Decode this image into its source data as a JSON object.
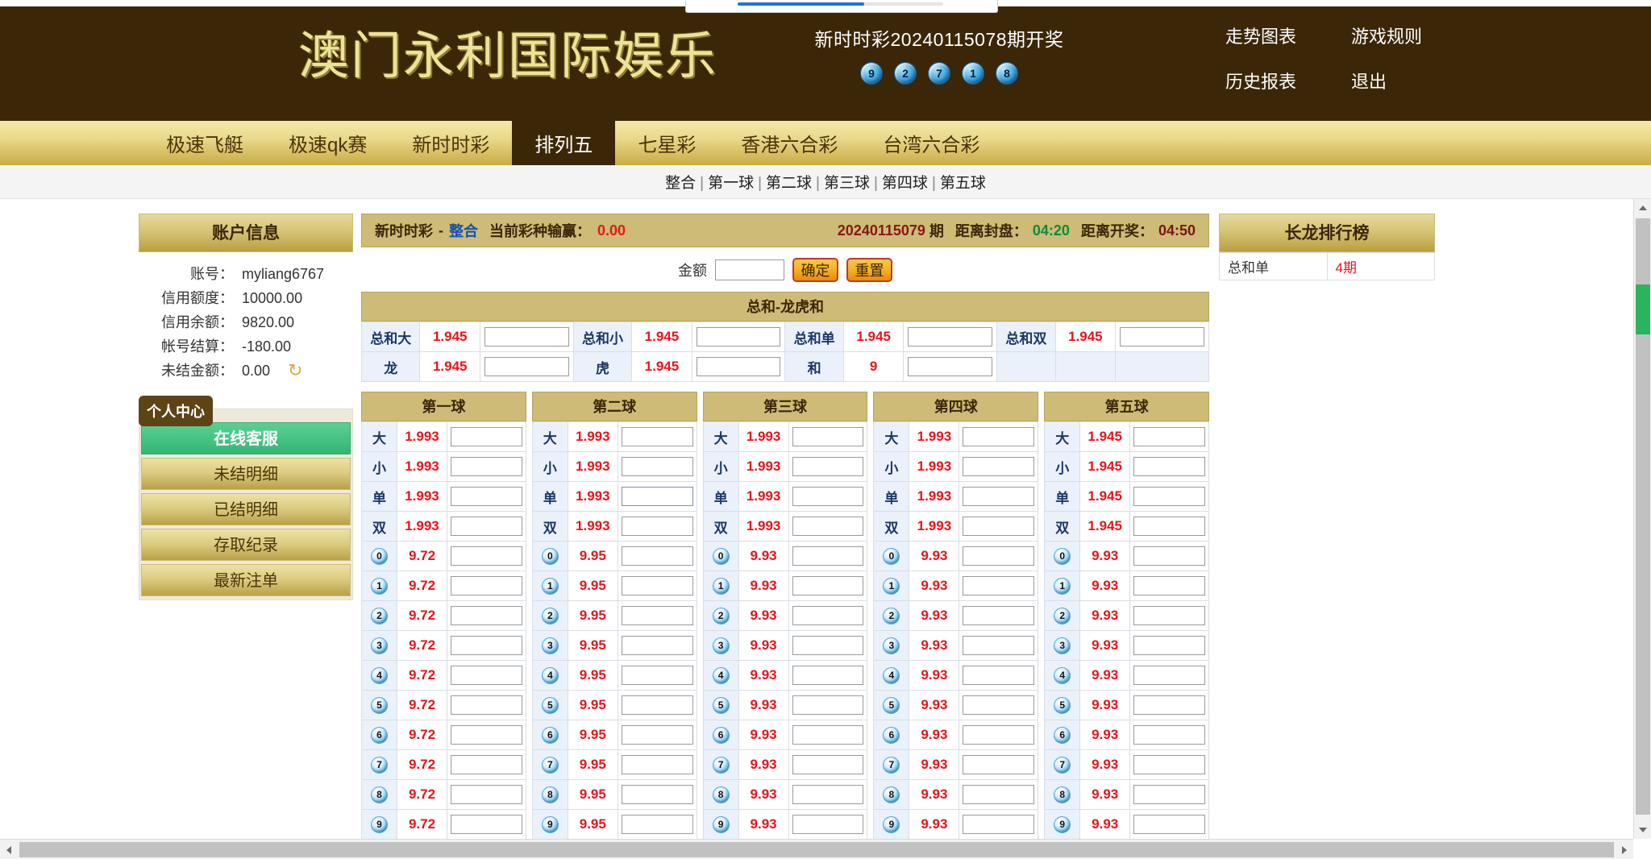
{
  "header": {
    "brand": "澳门永利国际娱乐",
    "draw_title": "新时时彩20240115078期开奖",
    "draw_balls": [
      "9",
      "2",
      "7",
      "1",
      "8"
    ],
    "nav": [
      {
        "label": "走势图表",
        "name": "trend-chart"
      },
      {
        "label": "游戏规则",
        "name": "game-rules"
      },
      {
        "label": "历史报表",
        "name": "history-report"
      },
      {
        "label": "退出",
        "name": "logout"
      }
    ]
  },
  "tabs": [
    {
      "label": "极速飞艇",
      "active": false
    },
    {
      "label": "极速qk赛",
      "active": false
    },
    {
      "label": "新时时彩",
      "active": false
    },
    {
      "label": "排列五",
      "active": true
    },
    {
      "label": "七星彩",
      "active": false
    },
    {
      "label": "香港六合彩",
      "active": false
    },
    {
      "label": "台湾六合彩",
      "active": false
    }
  ],
  "subnav": {
    "items": [
      "整合",
      "第一球",
      "第二球",
      "第三球",
      "第四球",
      "第五球"
    ],
    "separator": "|"
  },
  "sidebar": {
    "account_panel_title": "账户信息",
    "account_rows": [
      {
        "label": "账号：",
        "value": "myliang6767"
      },
      {
        "label": "信用额度：",
        "value": "10000.00"
      },
      {
        "label": "信用余额：",
        "value": "9820.00"
      },
      {
        "label": "帐号结算：",
        "value": "-180.00"
      },
      {
        "label": "未结金额：",
        "value": "0.00"
      }
    ],
    "refresh_icon": "↻",
    "center_badge": "个人中心",
    "menu": [
      {
        "label": "在线客服",
        "style": "service"
      },
      {
        "label": "未结明细",
        "style": "gold"
      },
      {
        "label": "已结明细",
        "style": "gold"
      },
      {
        "label": "存取纪录",
        "style": "gold"
      },
      {
        "label": "最新注单",
        "style": "gold"
      }
    ]
  },
  "main": {
    "info_bar": {
      "game": "新时时彩",
      "separator": "-",
      "mode": "整合",
      "pl_label": "当前彩种输赢：",
      "pl_value": "0.00",
      "period": "20240115079",
      "period_unit": "期",
      "close_label": "距离封盘：",
      "close_time": "04:20",
      "draw_label": "距离开奖：",
      "draw_time": "04:50"
    },
    "amount": {
      "label": "金额",
      "value": "",
      "placeholder": "",
      "confirm_label": "确定",
      "reset_label": "重置"
    },
    "sum_section": {
      "title": "总和-龙虎和",
      "rows": [
        [
          {
            "name": "总和大",
            "odds": "1.945",
            "value": ""
          },
          {
            "name": "总和小",
            "odds": "1.945",
            "value": ""
          },
          {
            "name": "总和单",
            "odds": "1.945",
            "value": ""
          },
          {
            "name": "总和双",
            "odds": "1.945",
            "value": ""
          }
        ],
        [
          {
            "name": "龙",
            "odds": "1.945",
            "value": ""
          },
          {
            "name": "虎",
            "odds": "1.945",
            "value": ""
          },
          {
            "name": "和",
            "odds": "9",
            "value": ""
          },
          {
            "name": "",
            "odds": "",
            "value": null
          }
        ]
      ]
    },
    "ball_columns": [
      {
        "title": "第一球",
        "bs_odds": "1.993",
        "num_odds": "9.72",
        "bs_rows": [
          "大",
          "小",
          "单",
          "双"
        ],
        "numbers": [
          "0",
          "1",
          "2",
          "3",
          "4",
          "5",
          "6",
          "7",
          "8",
          "9"
        ],
        "highlight_row": null
      },
      {
        "title": "第二球",
        "bs_odds": "1.993",
        "num_odds": "9.95",
        "bs_rows": [
          "大",
          "小",
          "单",
          "双"
        ],
        "numbers": [
          "0",
          "1",
          "2",
          "3",
          "4",
          "5",
          "6",
          "7",
          "8",
          "9"
        ],
        "highlight_row": 2
      },
      {
        "title": "第三球",
        "bs_odds": "1.993",
        "num_odds": "9.93",
        "bs_rows": [
          "大",
          "小",
          "单",
          "双"
        ],
        "numbers": [
          "0",
          "1",
          "2",
          "3",
          "4",
          "5",
          "6",
          "7",
          "8",
          "9"
        ],
        "highlight_row": null
      },
      {
        "title": "第四球",
        "bs_odds": "1.993",
        "num_odds": "9.93",
        "bs_rows": [
          "大",
          "小",
          "单",
          "双"
        ],
        "numbers": [
          "0",
          "1",
          "2",
          "3",
          "4",
          "5",
          "6",
          "7",
          "8",
          "9"
        ],
        "highlight_row": null
      },
      {
        "title": "第五球",
        "bs_odds": "1.945",
        "num_odds": "9.93",
        "bs_rows": [
          "大",
          "小",
          "单",
          "双"
        ],
        "numbers": [
          "0",
          "1",
          "2",
          "3",
          "4",
          "5",
          "6",
          "7",
          "8",
          "9"
        ],
        "highlight_row": null
      }
    ]
  },
  "right_panel": {
    "title": "长龙排行榜",
    "rows": [
      {
        "name": "总和单",
        "value": "4期"
      }
    ]
  },
  "colors": {
    "header_bg": "#3b2708",
    "brand_text": "#ece39a",
    "tab_gold": "#d6c477",
    "odds_red": "#e8141b",
    "accent_green": "#2bb35e"
  }
}
